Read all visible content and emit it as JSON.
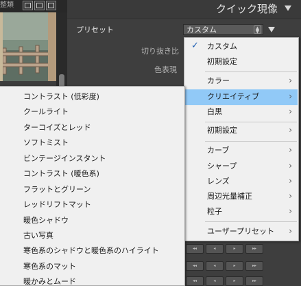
{
  "top_strip": {
    "label": "整類"
  },
  "panel": {
    "title": "クイック現像",
    "preset_label": "プリセット",
    "preset_value": "カスタム",
    "crop_label": "切り抜き比",
    "color_label": "色表現"
  },
  "preset_menu": {
    "items": [
      {
        "label": "カスタム",
        "checked": true,
        "arrow": false,
        "highlight": false
      },
      {
        "label": "初期設定",
        "checked": false,
        "arrow": false,
        "highlight": false
      },
      {
        "label": "カラー",
        "checked": false,
        "arrow": true,
        "highlight": false
      },
      {
        "label": "クリエイティブ",
        "checked": false,
        "arrow": true,
        "highlight": true
      },
      {
        "label": "白黒",
        "checked": false,
        "arrow": true,
        "highlight": false
      },
      {
        "label": "初期設定",
        "checked": false,
        "arrow": true,
        "highlight": false
      },
      {
        "label": "カーブ",
        "checked": false,
        "arrow": true,
        "highlight": false
      },
      {
        "label": "シャープ",
        "checked": false,
        "arrow": true,
        "highlight": false
      },
      {
        "label": "レンズ",
        "checked": false,
        "arrow": true,
        "highlight": false
      },
      {
        "label": "周辺光量補正",
        "checked": false,
        "arrow": true,
        "highlight": false
      },
      {
        "label": "粒子",
        "checked": false,
        "arrow": true,
        "highlight": false
      },
      {
        "label": "ユーザープリセット",
        "checked": false,
        "arrow": true,
        "highlight": false
      }
    ],
    "check_glyph": "✓",
    "arrow_glyph": "›"
  },
  "creative_submenu": {
    "items": [
      "コントラスト (低彩度)",
      "クールライト",
      "ターコイズとレッド",
      "ソフトミスト",
      "ビンテージインスタント",
      "コントラスト (暖色系)",
      "フラットとグリーン",
      "レッドリフトマット",
      "暖色シャドウ",
      "古い写真",
      "寒色系のシャドウと暖色系のハイライト",
      "寒色系のマット",
      "暖かみとムード"
    ]
  },
  "buttons": {
    "left_double": "◂◂",
    "left": "◂",
    "right": "▸",
    "right_double": "▸▸"
  },
  "colors": {
    "highlight": "#91c9f7",
    "menu_bg": "#f0f0f0",
    "panel_bg": "#3e3e3e"
  }
}
